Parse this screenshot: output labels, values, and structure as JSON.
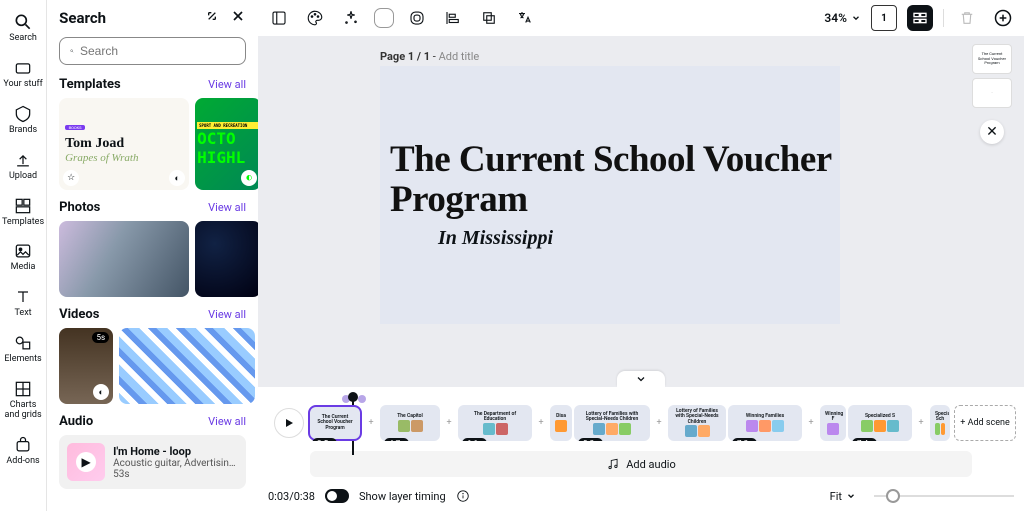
{
  "rail": {
    "items": [
      {
        "name": "search",
        "label": "Search"
      },
      {
        "name": "your-stuff",
        "label": "Your stuff"
      },
      {
        "name": "brands",
        "label": "Brands"
      },
      {
        "name": "upload",
        "label": "Upload"
      },
      {
        "name": "templates",
        "label": "Templates"
      },
      {
        "name": "media",
        "label": "Media"
      },
      {
        "name": "text",
        "label": "Text"
      },
      {
        "name": "elements",
        "label": "Elements"
      },
      {
        "name": "charts",
        "label": "Charts and grids"
      },
      {
        "name": "addons",
        "label": "Add-ons"
      }
    ]
  },
  "panel": {
    "title": "Search",
    "search_placeholder": "Search",
    "view_all_label": "View all",
    "sections": {
      "templates": {
        "title": "Templates"
      },
      "photos": {
        "title": "Photos"
      },
      "videos": {
        "title": "Videos"
      },
      "audio": {
        "title": "Audio"
      }
    },
    "template_card": {
      "line1": "Tom Joad",
      "line2": "Grapes of Wrath"
    },
    "template_card2": {
      "line1": "OCTO",
      "line2": "HIGHL"
    },
    "video_badge": "5s",
    "audio_track": {
      "title": "I'm Home - loop",
      "subtitle": "Acoustic guitar, Advertising, Bass, Bell…",
      "duration": "53s"
    }
  },
  "topbar": {
    "zoom": "34%"
  },
  "canvas": {
    "page_label_prefix": "Page 1 / 1",
    "page_label_separator": " - ",
    "page_label_suffix": "Add title",
    "slide_title": "The Current School Voucher Program",
    "slide_subtitle": "In Mississippi",
    "thumb1_text": "The Current School Voucher Program"
  },
  "timeline": {
    "add_scene": "+ Add scene",
    "add_audio": "Add audio",
    "playhead_time": "0:03/0:38",
    "show_layer_timing": "Show layer timing",
    "fit_label": "Fit",
    "scenes": [
      {
        "dur": "3.5s",
        "title": "The Current School Voucher Program",
        "selected": true
      },
      {
        "dur": "4.7s",
        "title": "The Capitol"
      },
      {
        "dur": "6.1s",
        "title": "The Department of Education"
      },
      {
        "dur": "",
        "title": "Disa"
      },
      {
        "dur": "8.3s",
        "title": "Lottery of Families with Special-Needs Children"
      },
      {
        "dur": "",
        "title": "Lottery of Families with Special-Needs Children"
      },
      {
        "dur": "7.3s",
        "title": "Winning Families"
      },
      {
        "dur": "",
        "title": "Winning F"
      },
      {
        "dur": "7.4s",
        "title": "Specialized S"
      },
      {
        "dur": "",
        "title": "Specialized Sch"
      }
    ]
  }
}
